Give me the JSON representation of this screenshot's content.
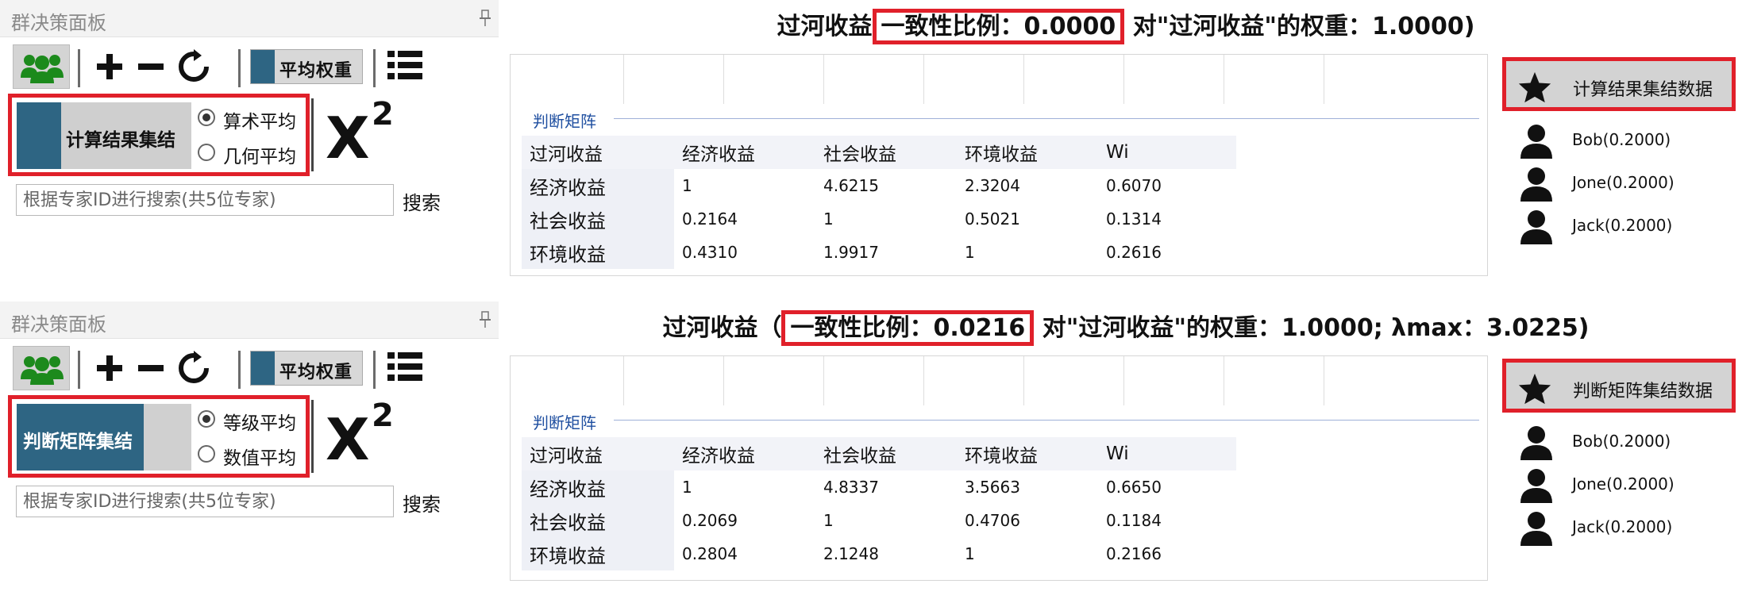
{
  "colors": {
    "accent": "#2e6583",
    "highlight": "#e0202a",
    "users_icon": "#1c8a1c",
    "link": "#1f4fa0"
  },
  "sections": [
    {
      "panel": {
        "title": "群决策面板",
        "toolbar": {
          "weight_label": "平均权重"
        },
        "aggregate_button": "计算结果集结",
        "radio_options": [
          "算术平均",
          "几何平均"
        ],
        "selected_radio": 0,
        "chi_icon_text": "X",
        "chi_icon_sup": "2",
        "search_placeholder": "根据专家ID进行搜索(共5位专家)",
        "search_button": "搜索"
      },
      "headline": {
        "criterion": "过河收益",
        "consistency": "一致性比例：0.0000",
        "rest": " 对\"过河收益\"的权重：1.0000)"
      },
      "matrix": {
        "group_label": "判断矩阵",
        "columns": [
          "过河收益",
          "经济收益",
          "社会收益",
          "环境收益",
          "Wi"
        ],
        "rows": [
          [
            "经济收益",
            "1",
            "4.6215",
            "2.3204",
            "0.6070"
          ],
          [
            "社会收益",
            "0.2164",
            "1",
            "0.5021",
            "0.1314"
          ],
          [
            "环境收益",
            "0.4310",
            "1.9917",
            "1",
            "0.2616"
          ]
        ]
      },
      "expert_panel": {
        "aggregate_data_button": "计算结果集结数据",
        "experts": [
          "Bob(0.2000)",
          "Jone(0.2000)",
          "Jack(0.2000)"
        ]
      }
    },
    {
      "panel": {
        "title": "群决策面板",
        "toolbar": {
          "weight_label": "平均权重"
        },
        "aggregate_button": "判断矩阵集结",
        "radio_options": [
          "等级平均",
          "数值平均"
        ],
        "selected_radio": 0,
        "chi_icon_text": "X",
        "chi_icon_sup": "2",
        "search_placeholder": "根据专家ID进行搜索(共5位专家)",
        "search_button": "搜索"
      },
      "headline": {
        "criterion": "过河收益（",
        "consistency": "一致性比例：0.0216",
        "rest": " 对\"过河收益\"的权重：1.0000; λmax：3.0225)"
      },
      "matrix": {
        "group_label": "判断矩阵",
        "columns": [
          "过河收益",
          "经济收益",
          "社会收益",
          "环境收益",
          "Wi"
        ],
        "rows": [
          [
            "经济收益",
            "1",
            "4.8337",
            "3.5663",
            "0.6650"
          ],
          [
            "社会收益",
            "0.2069",
            "1",
            "0.4706",
            "0.1184"
          ],
          [
            "环境收益",
            "0.2804",
            "2.1248",
            "1",
            "0.2166"
          ]
        ]
      },
      "expert_panel": {
        "aggregate_data_button": "判断矩阵集结数据",
        "experts": [
          "Bob(0.2000)",
          "Jone(0.2000)",
          "Jack(0.2000)"
        ]
      }
    }
  ]
}
